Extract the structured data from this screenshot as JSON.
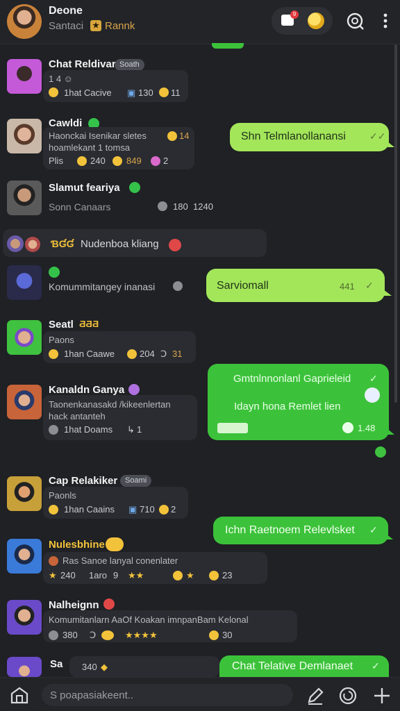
{
  "header": {
    "title": "Deone",
    "subtitle": "Santaci",
    "rank_label": "Rannk",
    "notification_count": "9"
  },
  "rows": [
    {
      "name": "Chat Reldivar",
      "tag": "Soath",
      "line1": "1 4 ☺",
      "meta": [
        "1hat Cacive",
        "130",
        "11"
      ]
    },
    {
      "name": "Cawldi",
      "line1": "Haonckai  Isenikar sletes",
      "line1_count": "14",
      "line2": "hoamlekant  1 tomsa",
      "meta": [
        "Plis",
        "240",
        "849",
        "2"
      ]
    },
    {
      "name": "Slamut feariya",
      "line1": "Sonn Canaars",
      "meta_right": [
        "180",
        "1240"
      ]
    },
    {
      "name": "Nudenboa kliang",
      "prefix": "ƁƓƓ"
    },
    {
      "line1": "Komummitangey inanasi"
    },
    {
      "name": "Seatl",
      "name_suffix": "ƋƋƋ",
      "line1": "Paons",
      "meta": [
        "1han Caawe",
        "204",
        "31"
      ]
    },
    {
      "name": "Kanaldn Ganya",
      "line1": "Taonenkanasakd /kikeenlertan",
      "line2": "hack antanteh",
      "meta": [
        "1hat Doams",
        "1"
      ]
    },
    {
      "name": "Cap Relakiker",
      "tag": "Soami",
      "line1": "Paonls",
      "meta": [
        "1han Caains",
        "710",
        "2"
      ]
    },
    {
      "name": "Nulesbhine",
      "line1": "Ras  Sanoe lanyal conenlater",
      "meta": [
        "240",
        "1aro",
        "9",
        "23"
      ]
    },
    {
      "name": "Nalheignn",
      "line1": "Komumitanlarn AaOf Koakan imnpanBam Kelonal",
      "meta": [
        "380",
        "30"
      ]
    },
    {
      "name": "Sa",
      "meta": [
        "340"
      ]
    }
  ],
  "bubbles": [
    {
      "text": "Shn Telmlanollanansi",
      "style": "light"
    },
    {
      "text": "Sarviomall",
      "time": "441",
      "style": "light"
    },
    {
      "text": "Gmtnlnnonlanl Gaprieleid",
      "text2": "Idayn hona Remlet lien",
      "time": "1.48",
      "style": "green"
    },
    {
      "text": "Ichn Raetnoem Relevlsket",
      "style": "green"
    },
    {
      "text": "Chat Telative Demlanaet",
      "style": "green"
    }
  ],
  "composer": {
    "placeholder": "S poapasiakeent.."
  },
  "colors": {
    "background": "#1f2125",
    "bubble_light": "#a3e65a",
    "bubble_green": "#3cc23a",
    "rank": "#d9a54a"
  },
  "icons": [
    "inbox-icon",
    "coin-icon",
    "search-icon",
    "more-icon",
    "home-icon",
    "edit-icon",
    "refresh-icon",
    "plus-icon",
    "double-check-icon"
  ]
}
